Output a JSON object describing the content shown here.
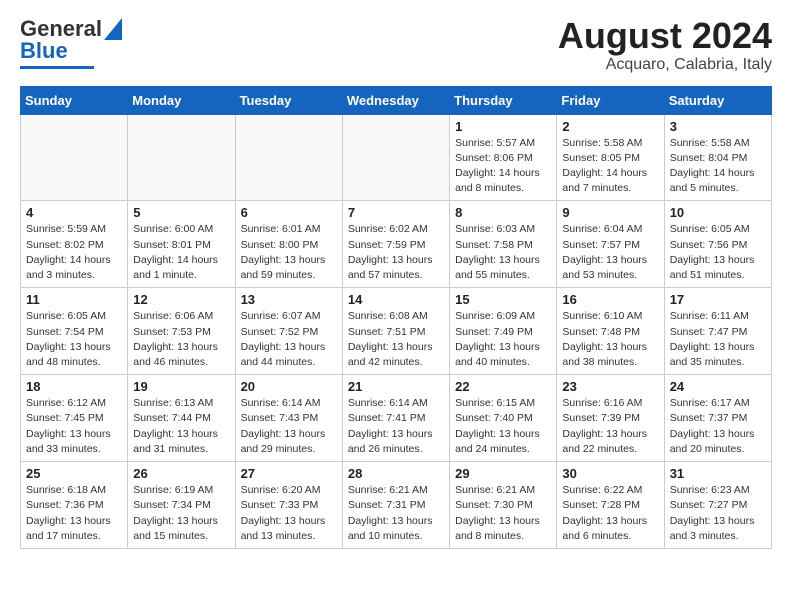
{
  "logo": {
    "general": "General",
    "blue": "Blue"
  },
  "header": {
    "month_year": "August 2024",
    "location": "Acquaro, Calabria, Italy"
  },
  "days_of_week": [
    "Sunday",
    "Monday",
    "Tuesday",
    "Wednesday",
    "Thursday",
    "Friday",
    "Saturday"
  ],
  "weeks": [
    [
      {
        "num": "",
        "info": ""
      },
      {
        "num": "",
        "info": ""
      },
      {
        "num": "",
        "info": ""
      },
      {
        "num": "",
        "info": ""
      },
      {
        "num": "1",
        "info": "Sunrise: 5:57 AM\nSunset: 8:06 PM\nDaylight: 14 hours\nand 8 minutes."
      },
      {
        "num": "2",
        "info": "Sunrise: 5:58 AM\nSunset: 8:05 PM\nDaylight: 14 hours\nand 7 minutes."
      },
      {
        "num": "3",
        "info": "Sunrise: 5:58 AM\nSunset: 8:04 PM\nDaylight: 14 hours\nand 5 minutes."
      }
    ],
    [
      {
        "num": "4",
        "info": "Sunrise: 5:59 AM\nSunset: 8:02 PM\nDaylight: 14 hours\nand 3 minutes."
      },
      {
        "num": "5",
        "info": "Sunrise: 6:00 AM\nSunset: 8:01 PM\nDaylight: 14 hours\nand 1 minute."
      },
      {
        "num": "6",
        "info": "Sunrise: 6:01 AM\nSunset: 8:00 PM\nDaylight: 13 hours\nand 59 minutes."
      },
      {
        "num": "7",
        "info": "Sunrise: 6:02 AM\nSunset: 7:59 PM\nDaylight: 13 hours\nand 57 minutes."
      },
      {
        "num": "8",
        "info": "Sunrise: 6:03 AM\nSunset: 7:58 PM\nDaylight: 13 hours\nand 55 minutes."
      },
      {
        "num": "9",
        "info": "Sunrise: 6:04 AM\nSunset: 7:57 PM\nDaylight: 13 hours\nand 53 minutes."
      },
      {
        "num": "10",
        "info": "Sunrise: 6:05 AM\nSunset: 7:56 PM\nDaylight: 13 hours\nand 51 minutes."
      }
    ],
    [
      {
        "num": "11",
        "info": "Sunrise: 6:05 AM\nSunset: 7:54 PM\nDaylight: 13 hours\nand 48 minutes."
      },
      {
        "num": "12",
        "info": "Sunrise: 6:06 AM\nSunset: 7:53 PM\nDaylight: 13 hours\nand 46 minutes."
      },
      {
        "num": "13",
        "info": "Sunrise: 6:07 AM\nSunset: 7:52 PM\nDaylight: 13 hours\nand 44 minutes."
      },
      {
        "num": "14",
        "info": "Sunrise: 6:08 AM\nSunset: 7:51 PM\nDaylight: 13 hours\nand 42 minutes."
      },
      {
        "num": "15",
        "info": "Sunrise: 6:09 AM\nSunset: 7:49 PM\nDaylight: 13 hours\nand 40 minutes."
      },
      {
        "num": "16",
        "info": "Sunrise: 6:10 AM\nSunset: 7:48 PM\nDaylight: 13 hours\nand 38 minutes."
      },
      {
        "num": "17",
        "info": "Sunrise: 6:11 AM\nSunset: 7:47 PM\nDaylight: 13 hours\nand 35 minutes."
      }
    ],
    [
      {
        "num": "18",
        "info": "Sunrise: 6:12 AM\nSunset: 7:45 PM\nDaylight: 13 hours\nand 33 minutes."
      },
      {
        "num": "19",
        "info": "Sunrise: 6:13 AM\nSunset: 7:44 PM\nDaylight: 13 hours\nand 31 minutes."
      },
      {
        "num": "20",
        "info": "Sunrise: 6:14 AM\nSunset: 7:43 PM\nDaylight: 13 hours\nand 29 minutes."
      },
      {
        "num": "21",
        "info": "Sunrise: 6:14 AM\nSunset: 7:41 PM\nDaylight: 13 hours\nand 26 minutes."
      },
      {
        "num": "22",
        "info": "Sunrise: 6:15 AM\nSunset: 7:40 PM\nDaylight: 13 hours\nand 24 minutes."
      },
      {
        "num": "23",
        "info": "Sunrise: 6:16 AM\nSunset: 7:39 PM\nDaylight: 13 hours\nand 22 minutes."
      },
      {
        "num": "24",
        "info": "Sunrise: 6:17 AM\nSunset: 7:37 PM\nDaylight: 13 hours\nand 20 minutes."
      }
    ],
    [
      {
        "num": "25",
        "info": "Sunrise: 6:18 AM\nSunset: 7:36 PM\nDaylight: 13 hours\nand 17 minutes."
      },
      {
        "num": "26",
        "info": "Sunrise: 6:19 AM\nSunset: 7:34 PM\nDaylight: 13 hours\nand 15 minutes."
      },
      {
        "num": "27",
        "info": "Sunrise: 6:20 AM\nSunset: 7:33 PM\nDaylight: 13 hours\nand 13 minutes."
      },
      {
        "num": "28",
        "info": "Sunrise: 6:21 AM\nSunset: 7:31 PM\nDaylight: 13 hours\nand 10 minutes."
      },
      {
        "num": "29",
        "info": "Sunrise: 6:21 AM\nSunset: 7:30 PM\nDaylight: 13 hours\nand 8 minutes."
      },
      {
        "num": "30",
        "info": "Sunrise: 6:22 AM\nSunset: 7:28 PM\nDaylight: 13 hours\nand 6 minutes."
      },
      {
        "num": "31",
        "info": "Sunrise: 6:23 AM\nSunset: 7:27 PM\nDaylight: 13 hours\nand 3 minutes."
      }
    ]
  ]
}
